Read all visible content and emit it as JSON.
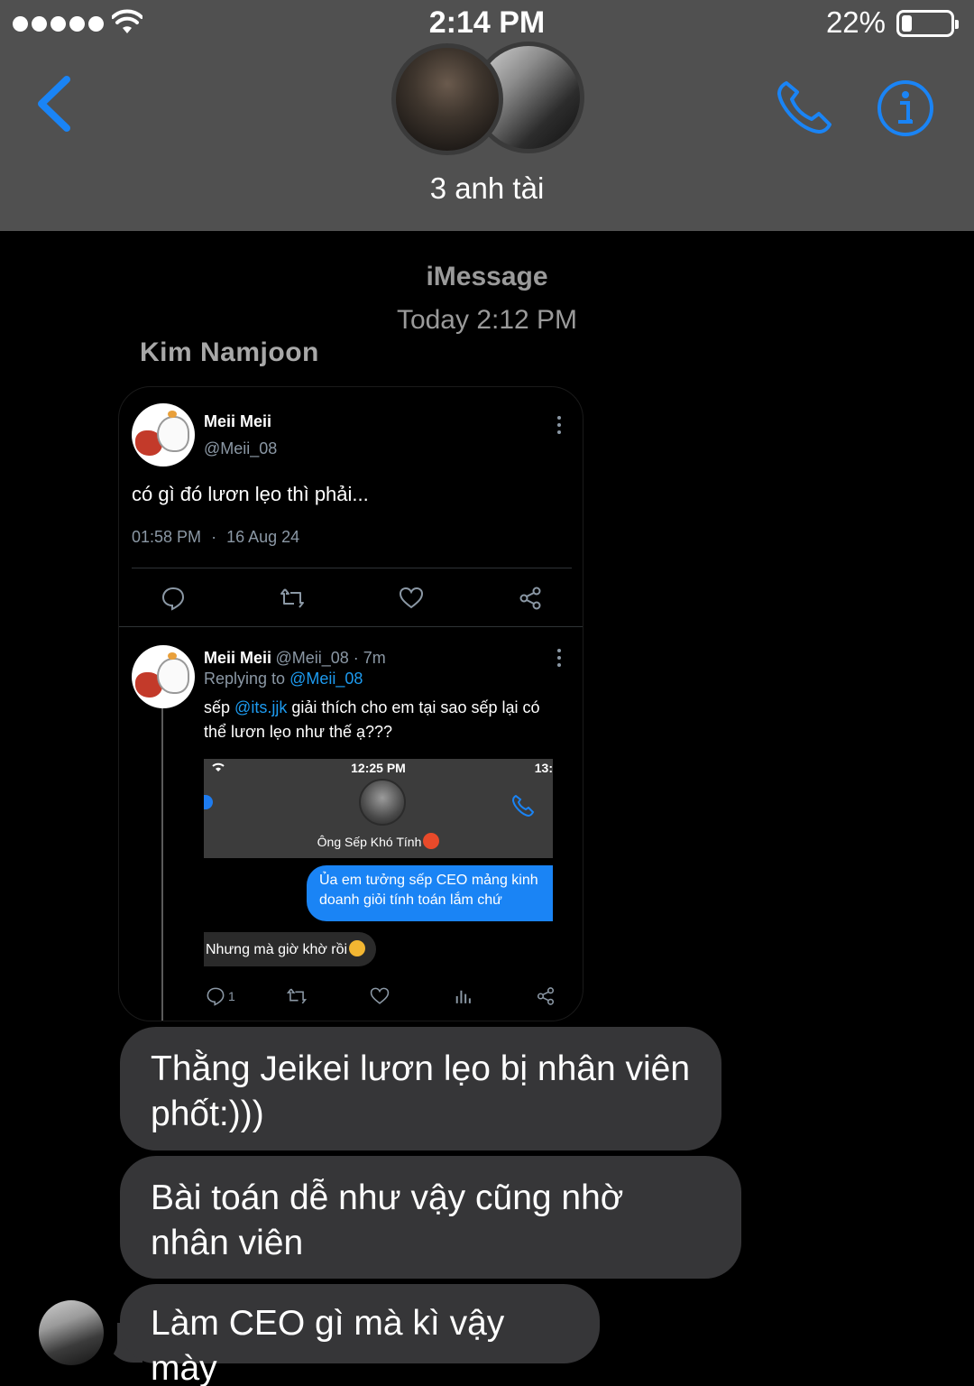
{
  "status_bar": {
    "time": "2:14 PM",
    "battery_percent": "22%",
    "battery_level": 0.22,
    "signal_dots": 5
  },
  "header": {
    "group_name": "3 anh tài",
    "accent_color": "#1a84f5"
  },
  "conversation": {
    "service": "iMessage",
    "timestamp": "Today 2:12 PM",
    "sender": "Kim Namjoon"
  },
  "tweet": {
    "author_name": "Meii Meii",
    "author_handle": "@Meii_08",
    "text": "có gì đó lươn lẹo thì phải...",
    "time": "01:58 PM",
    "separator": "·",
    "date": "16 Aug 24",
    "reply": {
      "author_name": "Meii Meii",
      "handle_time": "@Meii_08 · 7m",
      "replying_prefix": "Replying to",
      "replying_handle": "@Meii_08",
      "text_before": "sếp",
      "mention": "@its.jjk",
      "text_after": "giải thích cho em tại sao sếp lại có thể lươn lẹo như thế ạ???",
      "reply_count": "1",
      "screenshot": {
        "time": "12:25 PM",
        "time_cut": "13:",
        "contact_name": "Ông Sếp Khó Tính",
        "outgoing": "Ủa em tưởng sếp CEO mảng kinh doanh giỏi tính toán lắm chứ",
        "incoming": "Nhưng mà giờ khờ rồi"
      }
    }
  },
  "messages": [
    {
      "text": "Thằng Jeikei lươn lẹo bị nhân viên phốt:)))"
    },
    {
      "text": "Bài toán dễ như vậy cũng nhờ nhân viên"
    },
    {
      "text": "Làm CEO gì mà kì vậy mày"
    }
  ]
}
